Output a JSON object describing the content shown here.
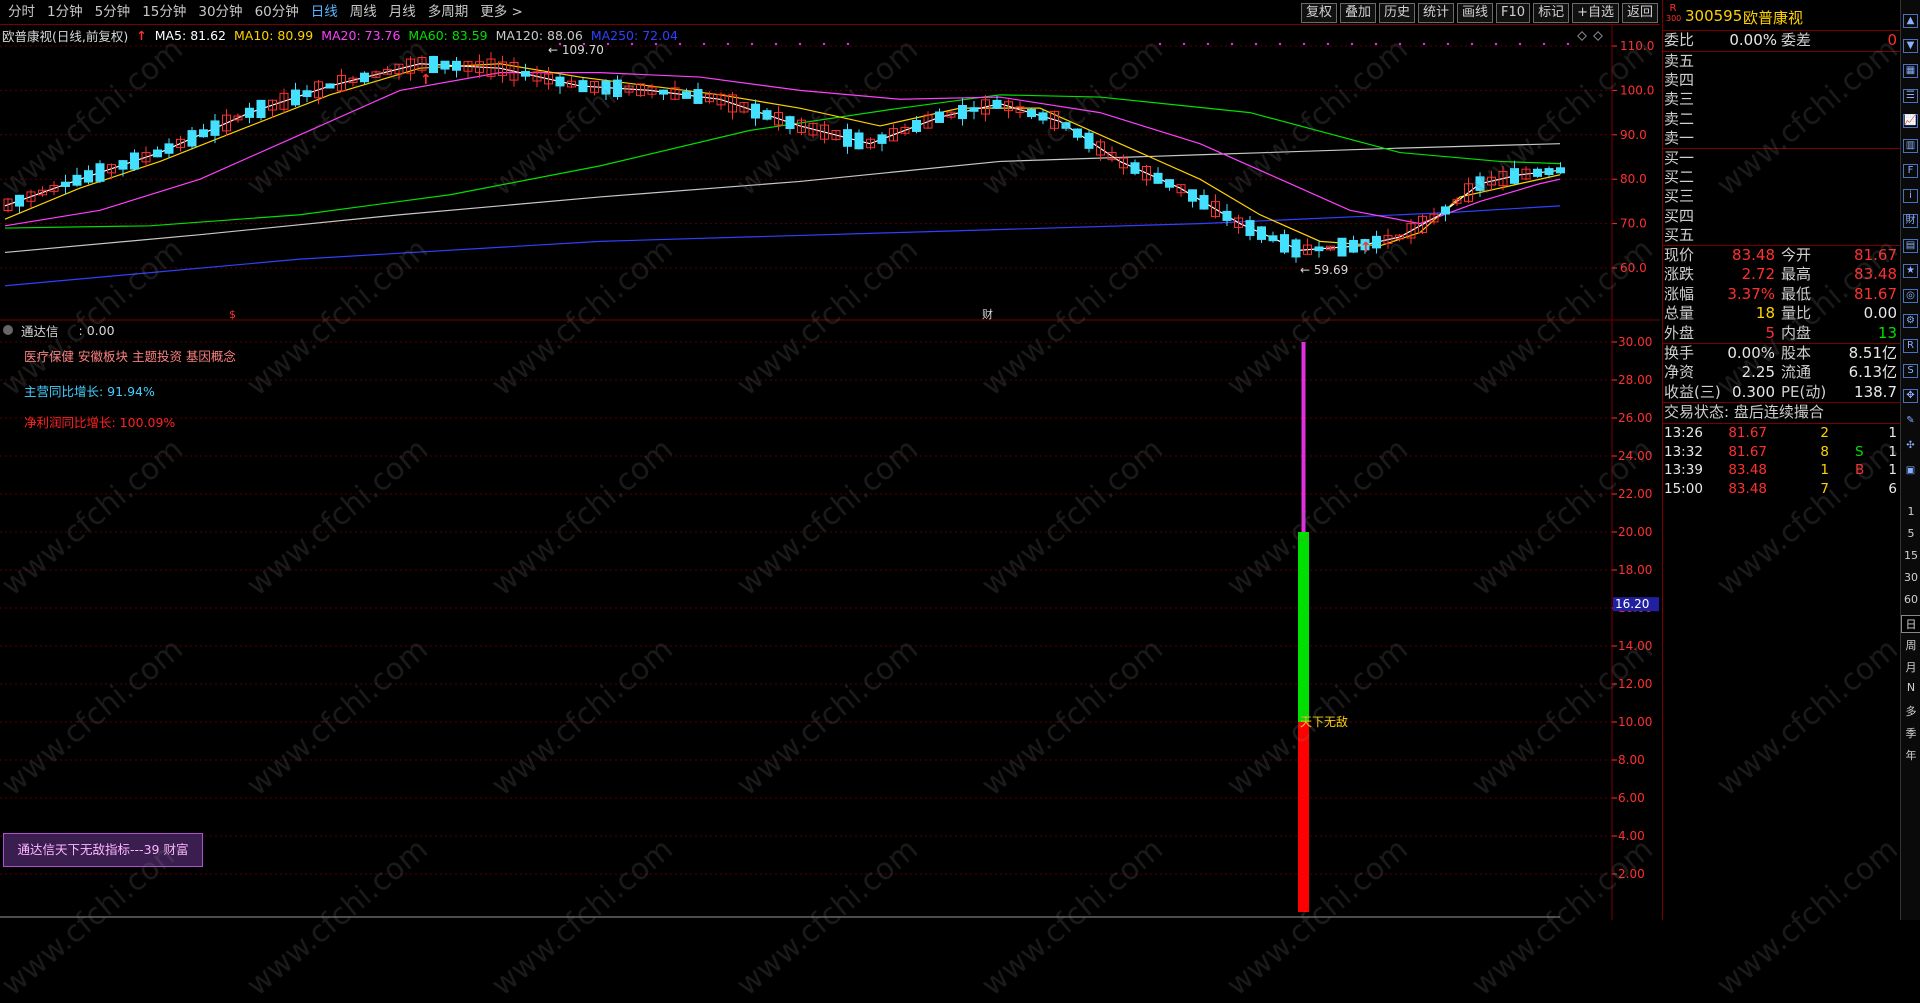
{
  "toolbar": {
    "periods": [
      "分时",
      "1分钟",
      "5分钟",
      "15分钟",
      "30分钟",
      "60分钟",
      "日线",
      "周线",
      "月线",
      "多周期",
      "更多"
    ],
    "more_arrow": ">",
    "tools": [
      "复权",
      "叠加",
      "历史",
      "统计",
      "画线",
      "F10",
      "标记",
      "+自选",
      "返回"
    ]
  },
  "main_chart": {
    "title": "欧普康视(日线,前复权)",
    "ma_labels": [
      {
        "text": "MA5: 81.62",
        "color": "#ffffff"
      },
      {
        "text": "MA10: 80.99",
        "color": "#ffd200"
      },
      {
        "text": "MA20: 73.76",
        "color": "#ff40ff"
      },
      {
        "text": "MA60: 83.59",
        "color": "#00e000"
      },
      {
        "text": "MA120: 88.06",
        "color": "#c8c8c8"
      },
      {
        "text": "MA250: 72.04",
        "color": "#3040ff"
      }
    ],
    "y_ticks": [
      "110.0",
      "100.0",
      "90.0",
      "80.0",
      "70.0",
      "60.0"
    ],
    "high_label": "109.70",
    "low_label": "59.69",
    "marker_s": "$",
    "marker_cai": "财"
  },
  "indicator": {
    "name": "通达信",
    "value": ": 0.00",
    "concepts": "医疗保健 安徽板块 主题投资 基因概念",
    "revenue_growth": "主营同比增长: 91.94%",
    "net_profit_growth": "净利润同比增长: 100.09%",
    "y_ticks": [
      "30.00",
      "28.00",
      "26.00",
      "24.00",
      "22.00",
      "20.00",
      "18.00",
      "16.00",
      "14.00",
      "12.00",
      "10.00",
      "8.00",
      "6.00",
      "4.00",
      "2.00"
    ],
    "current_tag": "16.20",
    "bar_label": "天下无敌",
    "info_box": "通达信天下无敌指标---39 财富",
    "bar_segments": [
      {
        "from": 0,
        "to": 10,
        "color": "#ff0000"
      },
      {
        "from": 10,
        "to": 20,
        "color": "#00e000"
      },
      {
        "from": 20,
        "to": 30,
        "color": "#e030e0"
      }
    ]
  },
  "quote": {
    "r_tag": "R",
    "r_num": "300",
    "code": "300595",
    "name": "欧普康视",
    "webi_label": "委比",
    "webi_value": "0.00%",
    "weicha_label": "委差",
    "weicha_value": "0",
    "sells": [
      "卖五",
      "卖四",
      "卖三",
      "卖二",
      "卖一"
    ],
    "buys": [
      "买一",
      "买二",
      "买三",
      "买四",
      "买五"
    ],
    "stats": [
      {
        "l1": "现价",
        "v1": "83.48",
        "c1": "red",
        "l2": "今开",
        "v2": "81.67",
        "c2": "red"
      },
      {
        "l1": "涨跌",
        "v1": "2.72",
        "c1": "red",
        "l2": "最高",
        "v2": "83.48",
        "c2": "red"
      },
      {
        "l1": "涨幅",
        "v1": "3.37%",
        "c1": "red",
        "l2": "最低",
        "v2": "81.67",
        "c2": "red"
      },
      {
        "l1": "总量",
        "v1": "18",
        "c1": "yellow",
        "l2": "量比",
        "v2": "0.00",
        "c2": "white"
      },
      {
        "l1": "外盘",
        "v1": "5",
        "c1": "red",
        "l2": "内盘",
        "v2": "13",
        "c2": "green"
      }
    ],
    "fundamentals": [
      {
        "l1": "换手",
        "v1": "0.00%",
        "l2": "股本",
        "v2": "8.51亿"
      },
      {
        "l1": "净资",
        "v1": "2.25",
        "l2": "流通",
        "v2": "6.13亿"
      },
      {
        "l1": "收益(三)",
        "v1": "0.300",
        "l2": "PE(动)",
        "v2": "138.7"
      }
    ],
    "trade_status": "交易状态: 盘后连续撮合",
    "ticks": [
      {
        "time": "13:26",
        "price": "81.67",
        "vol": "2",
        "flag": "",
        "n": "1"
      },
      {
        "time": "13:32",
        "price": "81.67",
        "vol": "8",
        "flag": "S",
        "n": "1"
      },
      {
        "time": "13:39",
        "price": "83.48",
        "vol": "1",
        "flag": "B",
        "n": "1"
      },
      {
        "time": "15:00",
        "price": "83.48",
        "vol": "7",
        "flag": "",
        "n": "6"
      }
    ]
  },
  "strip": {
    "periods": [
      "1",
      "5",
      "15",
      "30",
      "60",
      "日",
      "周",
      "月",
      "N",
      "多",
      "季",
      "年"
    ],
    "active_period": "日",
    "icons": [
      "up-arrow-icon",
      "down-arrow-icon",
      "grid-icon",
      "list-icon",
      "chart-icon",
      "bars-icon",
      "fund-icon",
      "info-icon",
      "fin-icon",
      "table-icon",
      "star-icon",
      "circle-icon",
      "gear-icon",
      "rsi-icon",
      "s-icon",
      "crosshair-icon",
      "pen-icon",
      "pan-icon",
      "screen-icon"
    ]
  },
  "watermark": "www.cfchi.com",
  "colors": {
    "up": "#ff3030",
    "down": "#44e0ff",
    "grid": "#7a0000"
  }
}
